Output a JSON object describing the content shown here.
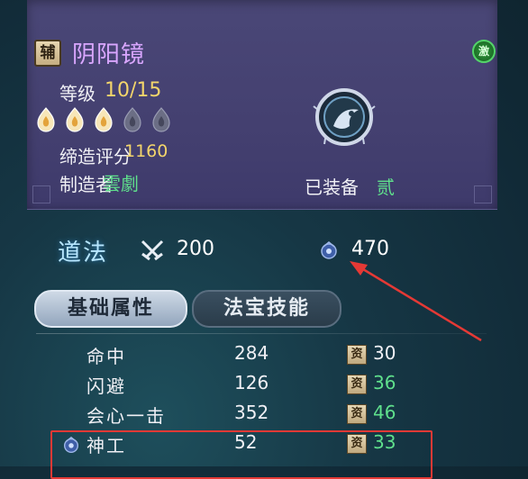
{
  "item": {
    "type_badge": "辅",
    "name": "阴阳镜",
    "activate_label": "激",
    "level_label": "等级",
    "level_current": "10",
    "level_max": "15",
    "score_label": "缔造评分",
    "score_value": "1160",
    "maker_label": "制造者",
    "maker_value": "雲劇",
    "equipped_label": "已装备",
    "equipped_value": "贰",
    "stars_lit": 3,
    "stars_total": 5
  },
  "stats": {
    "type_label": "道法",
    "attack": "200",
    "defense": "470"
  },
  "tabs": [
    {
      "label": "基础属性",
      "active": true
    },
    {
      "label": "法宝技能",
      "active": false
    }
  ],
  "attributes": [
    {
      "name": "命中",
      "value": "284",
      "apt_label": "资",
      "aptitude": "30",
      "apt_color": "#f0f0f5"
    },
    {
      "name": "闪避",
      "value": "126",
      "apt_label": "资",
      "aptitude": "36",
      "apt_color": "#5fe08c"
    },
    {
      "name": "会心一击",
      "value": "352",
      "apt_label": "资",
      "aptitude": "46",
      "apt_color": "#5fe08c"
    },
    {
      "name": "神工",
      "value": "52",
      "apt_label": "资",
      "aptitude": "33",
      "apt_color": "#5fe08c"
    }
  ],
  "colors": {
    "name_purple": "#d9a6ff",
    "gold": "#f3d56b",
    "green": "#5fe08c",
    "annotation_red": "#e53935"
  }
}
